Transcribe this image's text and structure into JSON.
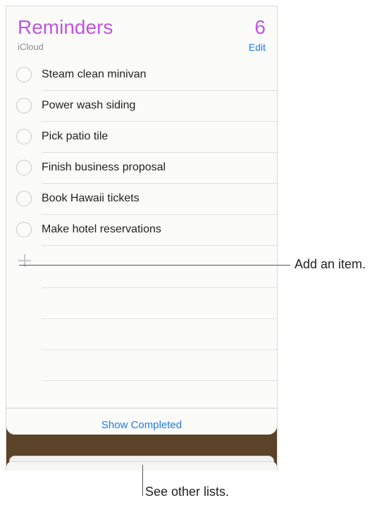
{
  "header": {
    "title": "Reminders",
    "count": "6",
    "account": "iCloud",
    "edit_label": "Edit"
  },
  "reminders": [
    {
      "text": "Steam clean minivan",
      "completed": false
    },
    {
      "text": "Power wash siding",
      "completed": false
    },
    {
      "text": "Pick patio tile",
      "completed": false
    },
    {
      "text": "Finish business proposal",
      "completed": false
    },
    {
      "text": "Book Hawaii tickets",
      "completed": false
    },
    {
      "text": "Make hotel reservations",
      "completed": false
    }
  ],
  "add_item": {
    "icon": "plus-icon"
  },
  "footer": {
    "show_completed_label": "Show Completed"
  },
  "callouts": {
    "add_item": "Add an item.",
    "other_lists": "See other lists."
  },
  "colors": {
    "accent_purple": "#c055e0",
    "link_blue": "#1a7ee8",
    "leather_brown": "#5b4329"
  }
}
